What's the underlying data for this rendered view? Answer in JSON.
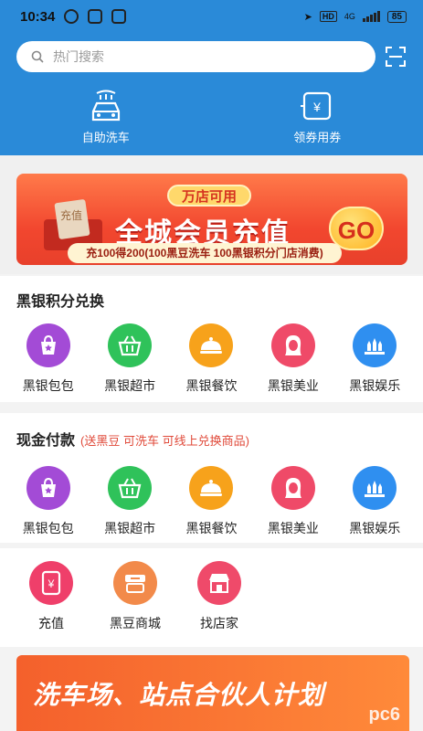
{
  "status": {
    "time": "10:34",
    "net": "HD",
    "signal": "4G",
    "battery": "85"
  },
  "search": {
    "placeholder": "热门搜索"
  },
  "header_actions": [
    {
      "label": "自助洗车",
      "icon": "car-wash-icon"
    },
    {
      "label": "领券用券",
      "icon": "coupon-icon"
    }
  ],
  "banner": {
    "tag": "万店可用",
    "title": "全城会员充值",
    "go": "GO",
    "subtitle": "充100得200(100黑豆洗车 100黑银积分门店消费)",
    "gift_text": "充值"
  },
  "points": {
    "title": "黑银积分兑换",
    "items": [
      {
        "label": "黑银包包",
        "icon": "bag-icon",
        "color": "#a34bd6"
      },
      {
        "label": "黑银超市",
        "icon": "basket-icon",
        "color": "#2fc25a"
      },
      {
        "label": "黑银餐饮",
        "icon": "dish-icon",
        "color": "#f7a21b"
      },
      {
        "label": "黑银美业",
        "icon": "beauty-icon",
        "color": "#ef4a68"
      },
      {
        "label": "黑银娱乐",
        "icon": "entertainment-icon",
        "color": "#2f8ff0"
      }
    ]
  },
  "cash": {
    "title": "现金付款",
    "note": "(送黑豆 可洗车 可线上兑换商品)",
    "items": [
      {
        "label": "黑银包包",
        "icon": "bag-icon",
        "color": "#a34bd6"
      },
      {
        "label": "黑银超市",
        "icon": "basket-icon",
        "color": "#2fc25a"
      },
      {
        "label": "黑银餐饮",
        "icon": "dish-icon",
        "color": "#f7a21b"
      },
      {
        "label": "黑银美业",
        "icon": "beauty-icon",
        "color": "#ef4a68"
      },
      {
        "label": "黑银娱乐",
        "icon": "entertainment-icon",
        "color": "#2f8ff0"
      }
    ]
  },
  "more": {
    "items": [
      {
        "label": "充值",
        "icon": "recharge-icon",
        "color": "#ef3f6a"
      },
      {
        "label": "黑豆商城",
        "icon": "mall-icon",
        "color": "#f28a4a"
      },
      {
        "label": "找店家",
        "icon": "store-icon",
        "color": "#ef4a6a"
      }
    ]
  },
  "partner": {
    "title": "洗车场、站点合伙人计划",
    "watermark": "pc6"
  },
  "colors": {
    "header": "#2a8ad8",
    "accent": "#e04a3a"
  }
}
